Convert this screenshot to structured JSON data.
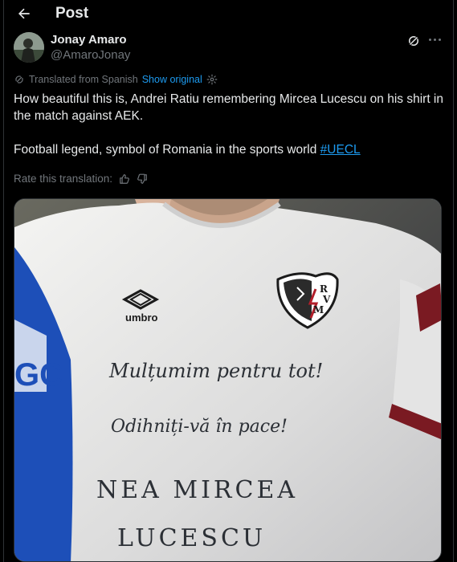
{
  "header": {
    "title": "Post"
  },
  "author": {
    "name": "Jonay Amaro",
    "handle": "@AmaroJonay"
  },
  "translation": {
    "label": "Translated from Spanish",
    "show_original": "Show original",
    "rate_label": "Rate this translation:"
  },
  "post": {
    "line1": "How beautiful this is, Andrei Ratiu remembering Mircea Lucescu on his shirt in the match against AEK.",
    "line2_prefix": "Football legend, symbol of Romania in the sports world ",
    "hashtag": "#UECL"
  },
  "media": {
    "brand": "umbro",
    "crest_letters": [
      "R",
      "V",
      "M"
    ],
    "side_letters": "GC",
    "handwriting": [
      "Mulțumim pentru tot!",
      "Odihniți-vă în pace!",
      "NEA MIRCEA",
      "LUCESCU"
    ]
  },
  "colors": {
    "background": "#000000",
    "text": "#e7e9ea",
    "muted": "#71767b",
    "accent": "#1d9bf0",
    "border": "#2f3336"
  },
  "icons": {
    "back": "arrow-left-icon",
    "grok": "grok-icon",
    "more": "more-horizontal-icon",
    "translate": "translate-icon",
    "settings": "gear-icon",
    "like": "thumbs-up-icon",
    "dislike": "thumbs-down-icon"
  }
}
